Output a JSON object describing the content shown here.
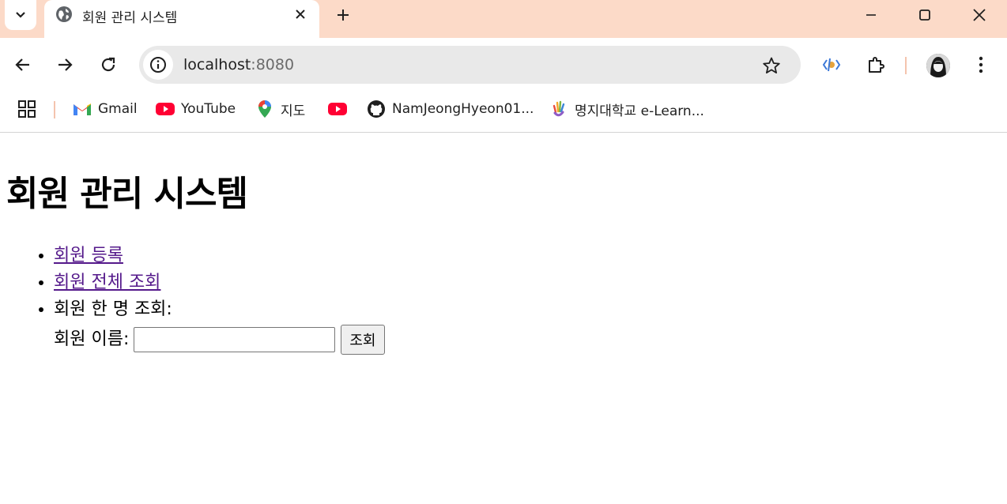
{
  "browser": {
    "tab_title": "회원 관리 시스템",
    "url_host": "localhost",
    "url_port": ":8080",
    "bookmarks": [
      {
        "label": "Gmail"
      },
      {
        "label": "YouTube"
      },
      {
        "label": "지도"
      },
      {
        "label": ""
      },
      {
        "label": "NamJeongHyeon01..."
      },
      {
        "label": "명지대학교 e-Learn..."
      }
    ]
  },
  "page": {
    "heading": "회원 관리 시스템",
    "links": {
      "register": "회원 등록",
      "list_all": "회원 전체 조회"
    },
    "single_lookup_label": "회원 한 명 조회:",
    "name_label": "회원 이름:",
    "name_input_value": "",
    "submit_label": "조회"
  },
  "colors": {
    "tabstrip": "#fcdac8",
    "link_visited": "#551a8b"
  }
}
